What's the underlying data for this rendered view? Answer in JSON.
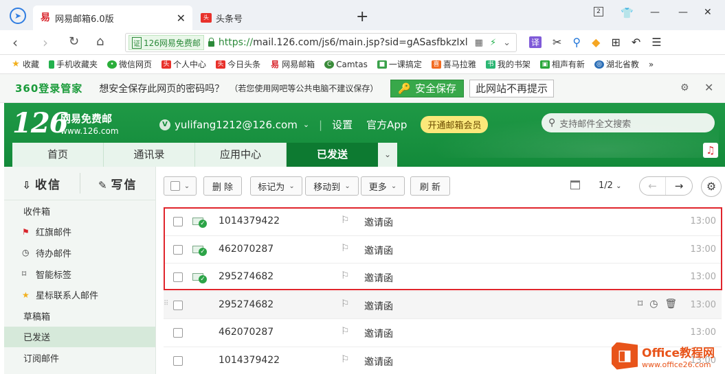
{
  "browser": {
    "tabs": [
      {
        "title": "网易邮箱6.0版",
        "favicon": "163-icon"
      },
      {
        "title": "头条号",
        "favicon": "toutiao-icon"
      }
    ],
    "new_tab": "+",
    "address": {
      "cert_label": "126网易免费邮",
      "cert_prefix": "证",
      "url_scheme": "https://",
      "url_rest": "mail.126.com/js6/main.jsp?sid=gASasfbkzIxl"
    },
    "toolbar": {
      "translate_label": "译"
    },
    "bookmarks": [
      {
        "label": "收藏",
        "icon": "star-icon",
        "color": "#f2b01e"
      },
      {
        "label": "手机收藏夹",
        "icon": "phone-icon",
        "color": "#23b14d"
      },
      {
        "label": "微信网页",
        "icon": "wechat-icon",
        "color": "#2aae3a"
      },
      {
        "label": "个人中心",
        "icon": "toutiao-icon",
        "color": "#e8312b"
      },
      {
        "label": "今日头条",
        "icon": "toutiao-icon",
        "color": "#e8312b"
      },
      {
        "label": "网易邮箱",
        "icon": "163-icon",
        "color": "#d8242b"
      },
      {
        "label": "Camtas",
        "icon": "camtasia-icon",
        "color": "#3a8b3a"
      },
      {
        "label": "一课搞定",
        "icon": "book-icon",
        "color": "#3aa14a"
      },
      {
        "label": "喜马拉雅",
        "icon": "ximalaya-icon",
        "color": "#f26b21"
      },
      {
        "label": "我的书架",
        "icon": "shelf-icon",
        "color": "#2bb673"
      },
      {
        "label": "相声有新",
        "icon": "media-icon",
        "color": "#2aa63a"
      },
      {
        "label": "湖北省教",
        "icon": "globe-icon",
        "color": "#2c6fb7"
      }
    ],
    "bookmarks_more": "»"
  },
  "password_bar": {
    "brand": "360登录管家",
    "message": "想安全保存此网页的密码吗？",
    "sub_message": "（若您使用网吧等公共电脑不建议保存）",
    "save_label": "安全保存",
    "never_label": "此网站不再提示"
  },
  "mail": {
    "logo": {
      "number": "126",
      "name": "网易免费邮",
      "domain": "www.126.com"
    },
    "user": "yulifang1212@126.com",
    "links": {
      "settings": "设置",
      "app": "官方App",
      "vip": "开通邮箱会员"
    },
    "search_placeholder": "支持邮件全文搜索",
    "tabs": [
      "首页",
      "通讯录",
      "应用中心",
      "已发送"
    ],
    "active_tab": "已发送",
    "compose": {
      "receive": "收信",
      "write": "写信"
    },
    "folders": [
      {
        "label": "收件箱",
        "icon": ""
      },
      {
        "label": "红旗邮件",
        "icon": "flag-icon"
      },
      {
        "label": "待办邮件",
        "icon": "clock-icon"
      },
      {
        "label": "智能标签",
        "icon": "bookmark-icon"
      },
      {
        "label": "星标联系人邮件",
        "icon": "star-icon"
      },
      {
        "label": "草稿箱",
        "icon": ""
      },
      {
        "label": "已发送",
        "icon": ""
      },
      {
        "label": "订阅邮件",
        "icon": ""
      }
    ],
    "active_folder": "已发送",
    "toolbar": {
      "delete": "删 除",
      "mark_as": "标记为",
      "move_to": "移动到",
      "more": "更多",
      "refresh": "刷 新",
      "page": "1/2"
    },
    "messages": [
      {
        "from": "1014379422",
        "subject": "邀请函",
        "time": "13:00",
        "read_icon": true
      },
      {
        "from": "462070287",
        "subject": "邀请函",
        "time": "13:00",
        "read_icon": true
      },
      {
        "from": "295274682",
        "subject": "邀请函",
        "time": "13:00",
        "read_icon": true
      },
      {
        "from": "295274682",
        "subject": "邀请函",
        "time": "13:00",
        "read_icon": false
      },
      {
        "from": "462070287",
        "subject": "邀请函",
        "time": "13:00",
        "read_icon": false
      },
      {
        "from": "1014379422",
        "subject": "邀请函",
        "time": "13:00",
        "read_icon": false
      }
    ]
  },
  "watermark": {
    "title": "Office教程网",
    "url": "www.office26.com"
  },
  "colors": {
    "mail_green": "#1f9946",
    "highlight_red": "#e0242b",
    "accent_orange": "#e8541a"
  }
}
